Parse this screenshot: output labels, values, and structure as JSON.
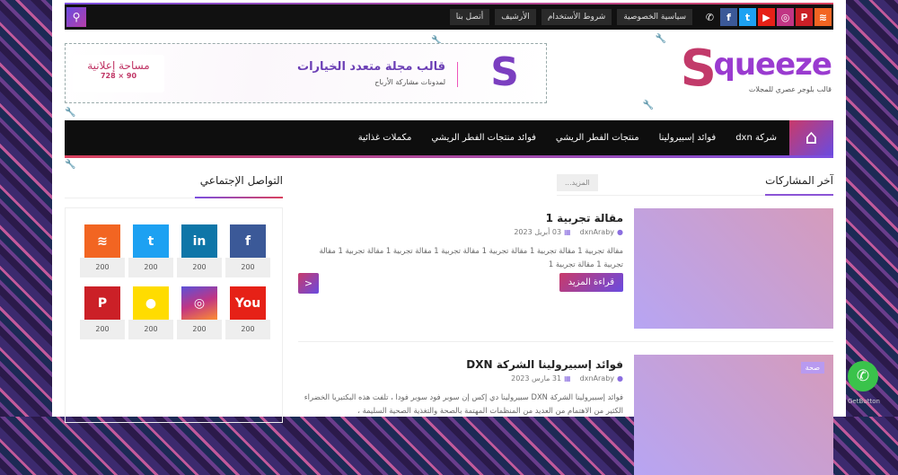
{
  "topbar": {
    "links": [
      "سياسية الخصوصية",
      "شروط الأستخدام",
      "الأرشيف",
      "أتصل بنا"
    ],
    "social": [
      {
        "name": "rss",
        "color": "#f26522",
        "glyph": "≋"
      },
      {
        "name": "pinterest",
        "color": "#cb2027",
        "glyph": "P"
      },
      {
        "name": "instagram",
        "color": "#c13584",
        "glyph": "◎"
      },
      {
        "name": "youtube",
        "color": "#e62117",
        "glyph": "▶"
      },
      {
        "name": "twitter",
        "color": "#1da1f2",
        "glyph": "t"
      },
      {
        "name": "facebook",
        "color": "#3b5998",
        "glyph": "f"
      }
    ],
    "whatsapp_glyph": "✆",
    "search_glyph": "⚲"
  },
  "logo": {
    "word": "queeze",
    "s": "S",
    "tagline": "قالب بلوجر عصري للمجلات"
  },
  "ad": {
    "title": "قالب مجلة متعدد الخيارات",
    "subtitle": "لمدونات مشاركة الأرباح",
    "logo": "S",
    "box_title": "مساحة إعلانية",
    "box_size": "728 × 90"
  },
  "nav": {
    "home_glyph": "⌂",
    "items": [
      "شركة dxn",
      "فوائد إسبيرولينا",
      "منتجات الفطر الريشي",
      "فوائد منتجات الفطر الريشي",
      "مكملات غذائية"
    ]
  },
  "section": {
    "title": "آخر المشاركات",
    "more": "المزيد..."
  },
  "posts": [
    {
      "title": "مقالة تجربية 1",
      "author": "dxnAraby",
      "date": "03 أبريل 2023",
      "excerpt": "مقالة تجربية 1 مقالة تجربية 1 مقالة تجربية 1 مقالة تجربية 1 مقالة تجربية 1 مقالة تجربية 1 مقالة تجربية 1 مقالة تجربية 1",
      "read_more": "قراءة المزيد",
      "share_glyph": "<"
    },
    {
      "title": "فوائد إسبيرولينا الشركة DXN",
      "author": "dxnAraby",
      "date": "31 مارس 2023",
      "excerpt": "فوائد إسبيرولينا الشركة DXN سبيرولينا دي إكس إن سوبر فود سوبر فودا ، تلفت هذه البكتيريا الخضراء الكثير من الاهتمام من العديد من المنظمات المهتمة بالصحة والتغذية الصحية السليمة ،",
      "badge": "صحة"
    }
  ],
  "sidebar": {
    "title": "التواصل الإجتماعي",
    "items": [
      {
        "name": "facebook",
        "glyph": "f",
        "color": "#3b5998",
        "count": "200"
      },
      {
        "name": "linkedin",
        "glyph": "in",
        "color": "#0e76a8",
        "count": "200"
      },
      {
        "name": "twitter",
        "glyph": "t",
        "color": "#1da1f2",
        "count": "200"
      },
      {
        "name": "rss",
        "glyph": "≋",
        "color": "#f26522",
        "count": "200"
      },
      {
        "name": "youtube",
        "glyph": "You",
        "color": "#e62117",
        "count": "200"
      },
      {
        "name": "instagram",
        "glyph": "◎",
        "color": "#c13584",
        "count": "200"
      },
      {
        "name": "snapchat",
        "glyph": "●",
        "color": "#ffdc00",
        "count": "200"
      },
      {
        "name": "pinterest",
        "glyph": "P",
        "color": "#cb2027",
        "count": "200"
      }
    ]
  },
  "float": {
    "whatsapp_glyph": "✆",
    "label": "GetButton"
  }
}
